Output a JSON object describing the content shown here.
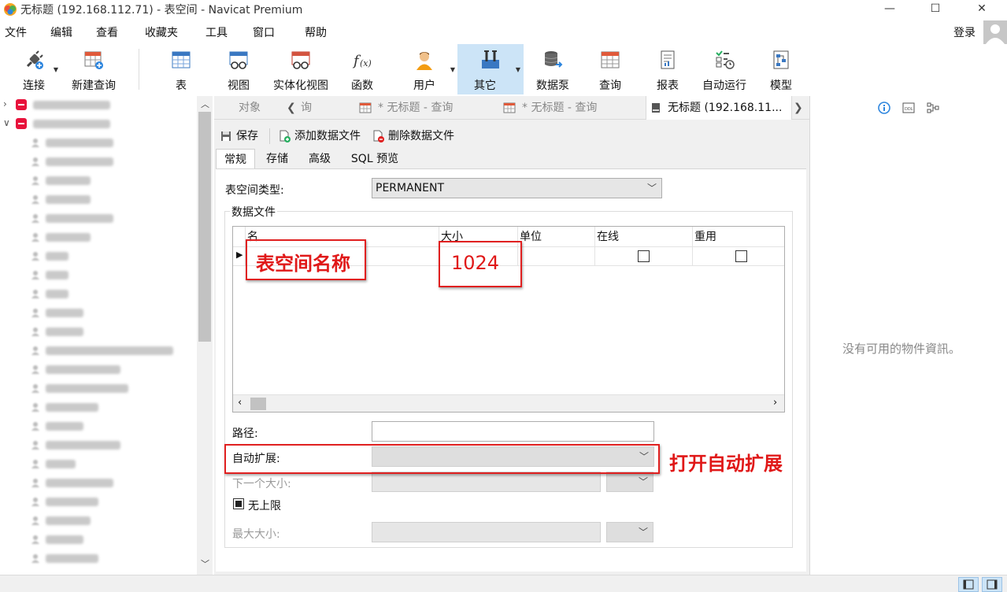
{
  "window": {
    "title": "无标题 (192.168.112.71) - 表空间 - Navicat Premium",
    "controls": {
      "minimize": "—",
      "maximize": "☐",
      "close": "✕"
    }
  },
  "menu": [
    "文件",
    "编辑",
    "查看",
    "收藏夹",
    "工具",
    "窗口",
    "帮助"
  ],
  "login": "登录",
  "toolbar": [
    {
      "id": "connect",
      "label": "连接",
      "icon": "plug-icon",
      "dropdown": true
    },
    {
      "id": "newquery",
      "label": "新建查询",
      "icon": "new-query-icon",
      "dropdown": false
    },
    {
      "id": "table",
      "label": "表",
      "icon": "table-icon",
      "dropdown": false
    },
    {
      "id": "view",
      "label": "视图",
      "icon": "view-icon",
      "dropdown": false
    },
    {
      "id": "mview",
      "label": "实体化视图",
      "icon": "materialized-view-icon",
      "dropdown": false
    },
    {
      "id": "function",
      "label": "函数",
      "icon": "function-icon",
      "dropdown": false
    },
    {
      "id": "user",
      "label": "用户",
      "icon": "user-icon",
      "dropdown": true
    },
    {
      "id": "others",
      "label": "其它",
      "icon": "tools-icon",
      "dropdown": true,
      "active": true
    },
    {
      "id": "datapump",
      "label": "数据泵",
      "icon": "data-pump-icon",
      "dropdown": false
    },
    {
      "id": "query",
      "label": "查询",
      "icon": "query-icon",
      "dropdown": false
    },
    {
      "id": "report",
      "label": "报表",
      "icon": "report-icon",
      "dropdown": false
    },
    {
      "id": "autorun",
      "label": "自动运行",
      "icon": "auto-run-icon",
      "dropdown": false
    },
    {
      "id": "model",
      "label": "模型",
      "icon": "model-icon",
      "dropdown": false
    }
  ],
  "tree": {
    "connections": [
      "119.96.225.243",
      "192.168.112.71"
    ],
    "users": [
      "ANONYMOUS",
      "APPQOSSYS",
      "AUDSYS",
      "CTXSYS",
      "DBSFWUSER",
      "DBSNMP",
      "DCS",
      "DIP",
      "DVF",
      "DVSYS",
      "GGSYS",
      "GSMADMIN_INTERNAL",
      "GSMCATUSER",
      "GSMROOTUSER",
      "GSMUSER",
      "JLINS",
      "JLINS_FILE",
      "JLTJ",
      "JLUSPRINT",
      "LBACSYS",
      "MDDATA",
      "MDSYS",
      "OJVMSYS"
    ]
  },
  "tabs": {
    "objects": "对象",
    "partial": "询",
    "query1": "* 无标题 - 查询",
    "query2": "* 无标题 - 查询",
    "current": "无标题 (192.168.11..."
  },
  "editor": {
    "save": "保存",
    "add_file": "添加数据文件",
    "delete_file": "删除数据文件",
    "subtabs": [
      "常规",
      "存储",
      "高级",
      "SQL 预览"
    ],
    "tablespace_type_label": "表空间类型:",
    "tablespace_type_value": "PERMANENT",
    "datafiles_label": "数据文件",
    "grid_headers": [
      "名",
      "大小",
      "单位",
      "在线",
      "重用"
    ],
    "path_label": "路径:",
    "autoextend_label": "自动扩展:",
    "next_size_label": "下一个大小:",
    "unlimited_label": "无上限",
    "max_size_label": "最大大小:"
  },
  "annotations": {
    "name": "表空间名称",
    "size": "1024",
    "autoextend": "打开自动扩展"
  },
  "rightpanel": {
    "empty": "没有可用的物件資訊。"
  },
  "colors": {
    "accent_active": "#cce4f7",
    "annotation_red": "#e02020",
    "connection_red": "#e8123b"
  }
}
